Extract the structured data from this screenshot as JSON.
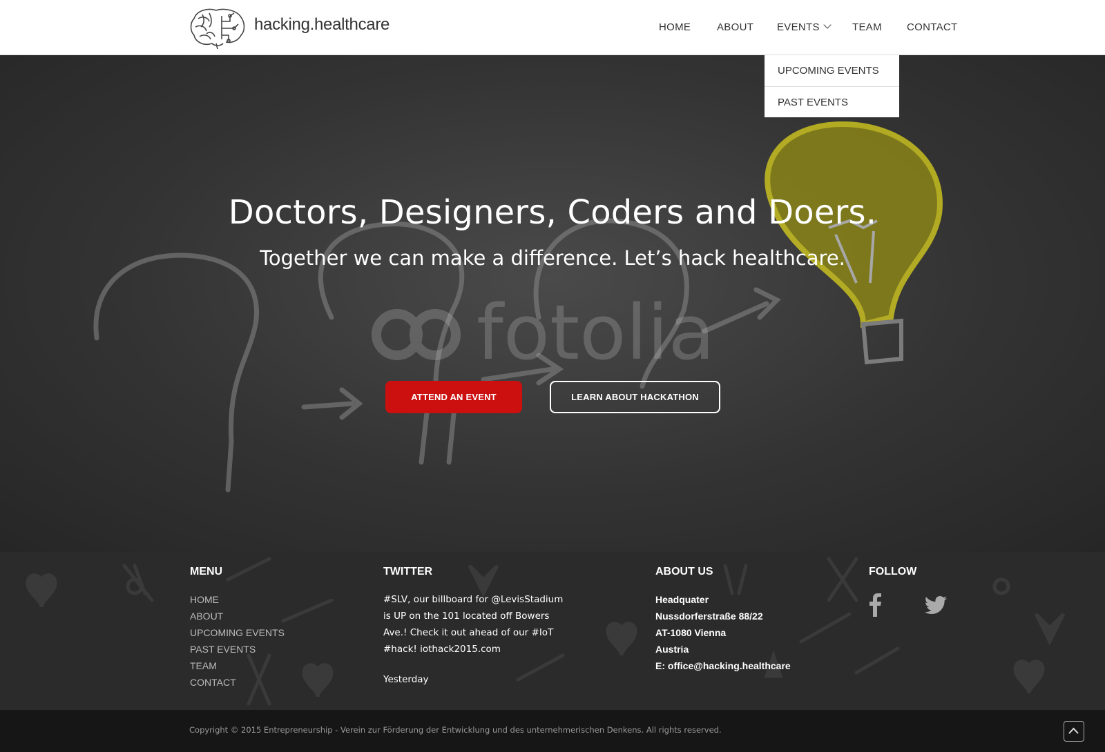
{
  "header": {
    "site_name": "hacking.healthcare",
    "nav": {
      "home": "HOME",
      "about": "ABOUT",
      "events": "EVENTS",
      "team": "TEAM",
      "contact": "CONTACT"
    },
    "dropdown": {
      "upcoming": "UPCOMING EVENTS",
      "past": "PAST EVENTS"
    }
  },
  "hero": {
    "title": "Doctors, Designers, Coders and Doers.",
    "subtitle": "Together we can make a difference. Let’s hack healthcare.",
    "watermark": "fotolia",
    "primary_button": "ATTEND AN EVENT",
    "secondary_button": "LEARN ABOUT HACKATHON"
  },
  "footer": {
    "menu": {
      "title": "MENU",
      "items": [
        "HOME",
        "ABOUT",
        "UPCOMING EVENTS",
        "PAST EVENTS",
        "TEAM",
        "CONTACT"
      ]
    },
    "twitter": {
      "title": "TWITTER",
      "tweet": "#SLV, our billboard for @LevisStadium is UP on the 101 located off Bowers Ave.! Check it out ahead of our #IoT #hack! iothack2015.com",
      "time": "Yesterday"
    },
    "about": {
      "title": "ABOUT US",
      "lines": [
        "Headquater",
        "Nussdorferstraße 88/22",
        "AT-1080 Vienna",
        "Austria",
        "E: office@hacking.healthcare"
      ]
    },
    "follow": {
      "title": "FOLLOW",
      "icons": [
        "facebook-icon",
        "twitter-icon"
      ]
    }
  },
  "bottom": {
    "copyright": "Copyright © 2015 Entrepreneurship - Verein zur Förderung der Entwicklung und des unternehmerischen Denkens. All rights reserved."
  },
  "colors": {
    "accent_red": "#cc1010",
    "bulb_yellow": "#c8c020",
    "footer_bg": "#2b2b2b",
    "bottom_bg": "#161616"
  }
}
